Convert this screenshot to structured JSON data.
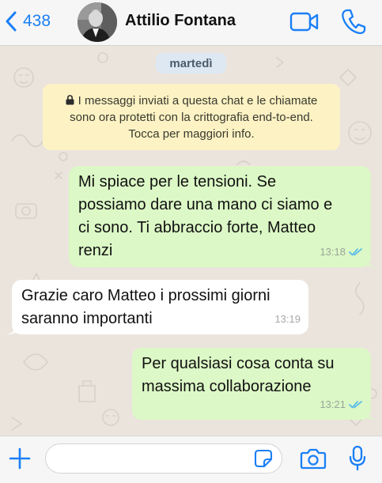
{
  "header": {
    "back_count": "438",
    "contact_name": "Attilio Fontana",
    "icons": {
      "back": "chevron-left-icon",
      "video": "video-call-icon",
      "call": "phone-icon"
    }
  },
  "chat": {
    "date_label": "martedì",
    "encryption_notice": "I messaggi inviati a questa chat e le chiamate sono ora protetti con la crittografia end-to-end. Tocca per maggiori info.",
    "messages": [
      {
        "direction": "outgoing",
        "lines": [
          "Mi spiace per le tensioni. Se",
          "possiamo dare una mano ci siamo e",
          "ci sono. Ti abbraccio forte, Matteo",
          "renzi"
        ],
        "time": "13:18",
        "status": "read"
      },
      {
        "direction": "incoming",
        "lines": [
          "Grazie caro Matteo i prossimi giorni",
          "saranno importanti"
        ],
        "time": "13:19"
      },
      {
        "direction": "outgoing",
        "lines": [
          "Per qualsiasi cosa conta su",
          "massima collaborazione"
        ],
        "time": "13:21",
        "status": "read"
      }
    ]
  },
  "composer": {
    "input_value": "",
    "icons": {
      "add": "plus-icon",
      "sticker": "sticker-icon",
      "camera": "camera-icon",
      "mic": "microphone-icon"
    }
  },
  "colors": {
    "accent": "#1a7ff6",
    "outgoing_bubble": "#dcf8c6",
    "incoming_bubble": "#ffffff",
    "read_ticks": "#4fb6ec",
    "encryption_bg": "#fcf2c4",
    "date_pill_bg": "#dde8f2",
    "chat_bg": "#ebe4dd"
  }
}
